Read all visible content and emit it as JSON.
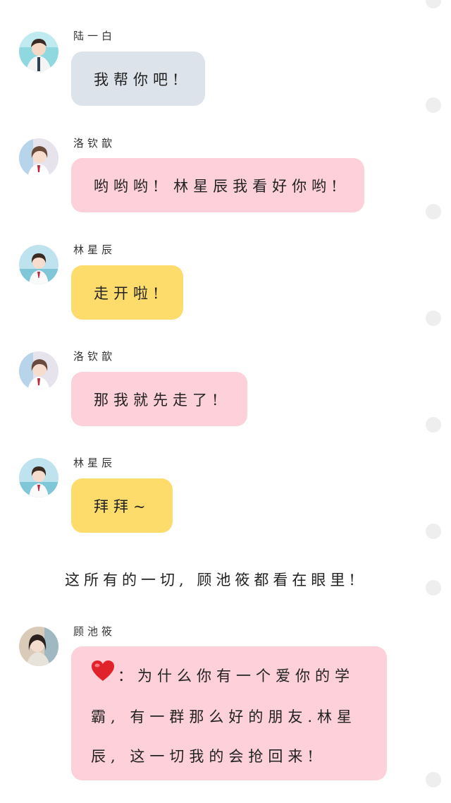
{
  "messages": [
    {
      "sender": "陆一白",
      "text": "我帮你吧!",
      "bubble_color": "#dde3ea"
    },
    {
      "sender": "洛钦歆",
      "text": "哟哟哟! 林星辰我看好你哟!",
      "bubble_color": "#fdd0da"
    },
    {
      "sender": "林星辰",
      "text": "走开啦!",
      "bubble_color": "#fddc6c"
    },
    {
      "sender": "洛钦歆",
      "text": "那我就先走了!",
      "bubble_color": "#fdd0da"
    },
    {
      "sender": "林星辰",
      "text": "拜拜~",
      "bubble_color": "#fddc6c"
    }
  ],
  "narration": "这所有的一切, 顾池筱都看在眼里!",
  "final_message": {
    "sender": "顾池筱",
    "icon": "red-heart-icon",
    "lines": [
      "：为什么你有一个爱你的学",
      "霸, 有一群那么好的朋友.林星",
      "辰, 这一切我的会抢回来!"
    ],
    "bubble_color": "#fdd0da"
  },
  "colors": {
    "background": "#ffffff",
    "side_dot": "#eeeeee",
    "heart": "#e0232b"
  }
}
